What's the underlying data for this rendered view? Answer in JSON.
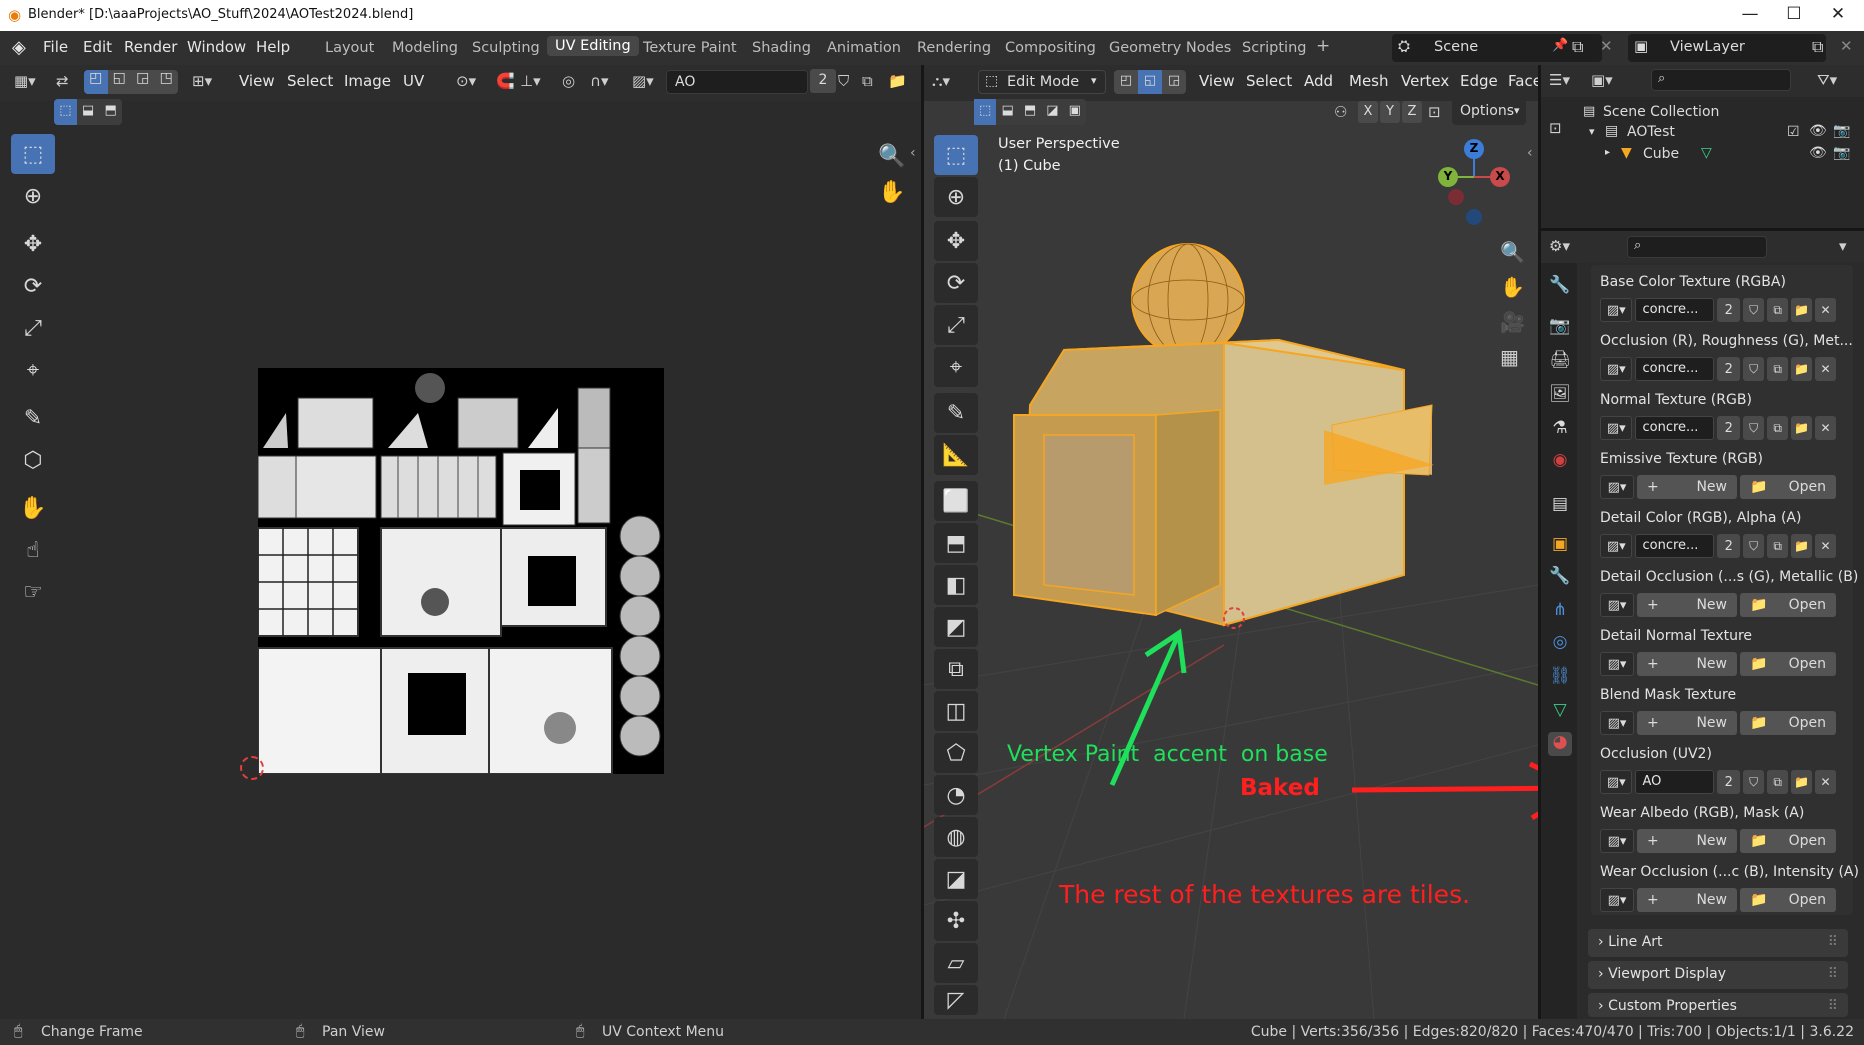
{
  "window": {
    "title": "Blender* [D:\\aaaProjects\\AO_Stuff\\2024\\AOTest2024.blend]",
    "controls": [
      "—",
      "☐",
      "✕"
    ]
  },
  "menubar": {
    "items": [
      "File",
      "Edit",
      "Render",
      "Window",
      "Help"
    ],
    "workspaces": [
      "Layout",
      "Modeling",
      "Sculpting",
      "UV Editing",
      "Texture Paint",
      "Shading",
      "Animation",
      "Rendering",
      "Compositing",
      "Geometry Nodes",
      "Scripting"
    ],
    "active_workspace": "UV Editing",
    "add_tab": "+",
    "scene": "Scene",
    "view_layer": "ViewLayer"
  },
  "uv_editor": {
    "menus": [
      "View",
      "Select",
      "Image",
      "UV"
    ],
    "image_name": "AO",
    "users": "2"
  },
  "viewport": {
    "mode": "Edit Mode",
    "menus": [
      "View",
      "Select",
      "Add",
      "Mesh",
      "Vertex",
      "Edge",
      "Face"
    ],
    "axes": [
      "X",
      "Y",
      "Z"
    ],
    "options": "Options",
    "perspective": "User Perspective",
    "object": "(1) Cube",
    "gizmo": {
      "x": "X",
      "y": "Y",
      "z": "Z"
    },
    "annotations": {
      "green": "Vertex Paint  accent  on base",
      "baked": "Baked",
      "tiles": "The rest of the textures are tiles."
    }
  },
  "outliner": {
    "root": "Scene Collection",
    "collection": "AOTest",
    "object": "Cube"
  },
  "properties": {
    "slots": [
      {
        "label": "Base Color Texture (RGBA)",
        "image": "concre...",
        "users": "2"
      },
      {
        "label": "Occlusion (R), Roughness (G), Met...",
        "image": "concre...",
        "users": "2"
      },
      {
        "label": "Normal Texture (RGB)",
        "image": "concre...",
        "users": "2"
      },
      {
        "label": "Emissive Texture (RGB)",
        "new": "New",
        "open": "Open"
      },
      {
        "label": "Detail Color (RGB), Alpha (A)",
        "image": "concre...",
        "users": "2"
      },
      {
        "label": "Detail Occlusion (...s (G), Metallic (B)",
        "new": "New",
        "open": "Open"
      },
      {
        "label": "Detail Normal Texture",
        "new": "New",
        "open": "Open"
      },
      {
        "label": "Blend Mask Texture",
        "new": "New",
        "open": "Open"
      },
      {
        "label": "Occlusion (UV2)",
        "image": "AO",
        "users": "2"
      },
      {
        "label": "Wear Albedo (RGB), Mask (A)",
        "new": "New",
        "open": "Open"
      },
      {
        "label": "Wear Occlusion (...c (B), Intensity (A)",
        "new": "New",
        "open": "Open"
      }
    ],
    "collapsed": [
      "Line Art",
      "Viewport Display",
      "Custom Properties"
    ]
  },
  "statusbar": {
    "left": "Change Frame",
    "middle": "Pan View",
    "right": "UV Context Menu",
    "stats": "Cube | Verts:356/356 | Edges:820/820 | Faces:470/470 | Tris:700 | Objects:1/1 | 3.6.22"
  },
  "colors": {
    "accent": "#4772b3",
    "selected_orange": "#f5a623",
    "annotation_green": "#1ee05a",
    "annotation_red": "#ff1f1f"
  }
}
